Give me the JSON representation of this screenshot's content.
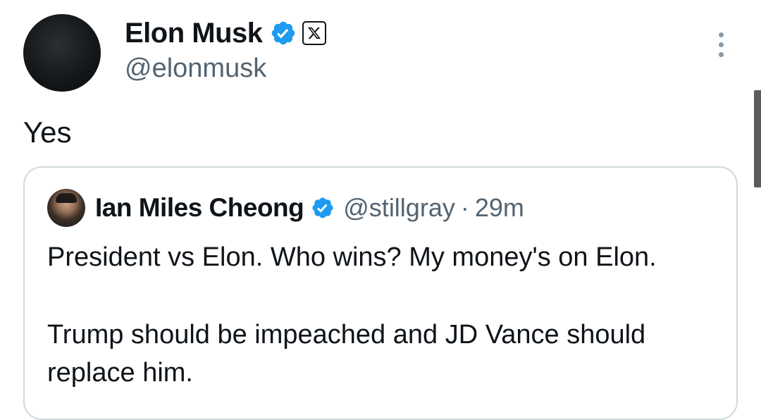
{
  "tweet": {
    "author": {
      "name": "Elon Musk",
      "handle": "@elonmusk",
      "verified_icon": "verified-badge-icon",
      "affiliate_icon": "x-logo-icon"
    },
    "text": "Yes",
    "menu_icon": "more-vertical-icon"
  },
  "quote": {
    "author": {
      "name": "Ian Miles Cheong",
      "handle": "@stillgray",
      "separator": "·",
      "time": "29m",
      "verified_icon": "verified-badge-icon"
    },
    "paragraphs": [
      "President vs Elon. Who wins? My money's on Elon.",
      "Trump should be impeached and JD Vance should replace him."
    ]
  },
  "colors": {
    "verified_blue": "#1d9bf0",
    "secondary_text": "#536471",
    "border": "#cfd9de"
  }
}
